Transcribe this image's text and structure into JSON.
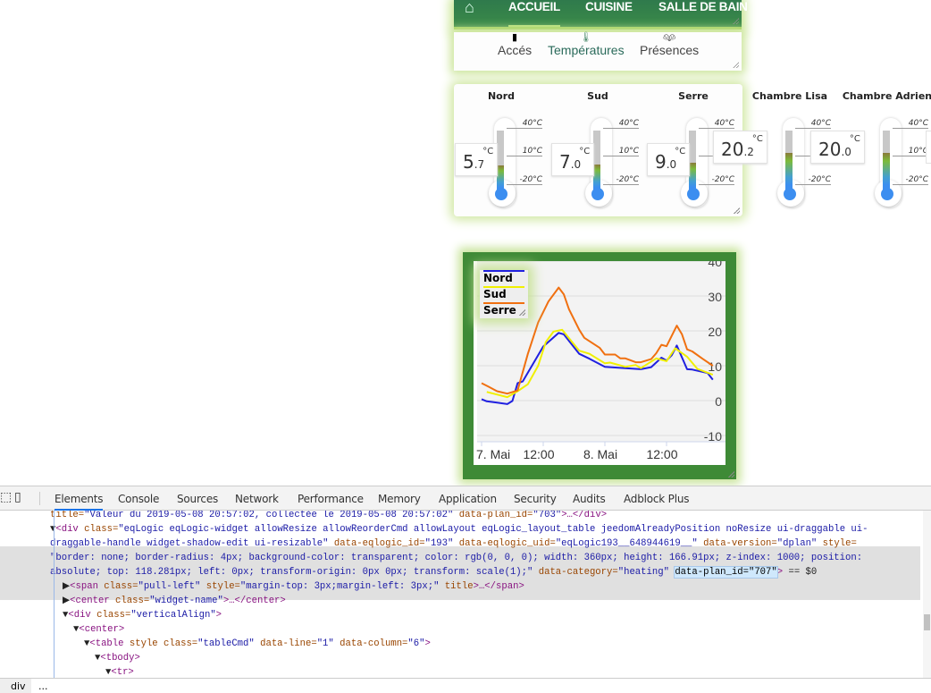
{
  "nav": {
    "home_icon": "house-icon",
    "items": [
      "ACCUEIL",
      "CUISINE",
      "SALLE DE BAIN"
    ],
    "active": "ACCUEIL"
  },
  "subnav": {
    "items": [
      {
        "label": "Accés",
        "icon": "door-icon"
      },
      {
        "label": "Températures",
        "icon": "thermometer-icon"
      },
      {
        "label": "Présences",
        "icon": "people-icon"
      }
    ]
  },
  "thermometers": {
    "scale": [
      "40°C",
      "10°C",
      "-20°C"
    ],
    "unit": "°C",
    "items": [
      {
        "name": "Nord",
        "int": "5",
        "dec": ".7",
        "value": 5.7
      },
      {
        "name": "Sud",
        "int": "7",
        "dec": ".0",
        "value": 7.0
      },
      {
        "name": "Serre",
        "int": "9",
        "dec": ".0",
        "value": 9.0
      },
      {
        "name": "Chambre Lisa",
        "int": "20",
        "dec": ".2",
        "value": 20.2
      },
      {
        "name": "Chambre Adrien",
        "int": "20",
        "dec": ".0",
        "value": 20.0
      }
    ]
  },
  "chart_data": {
    "type": "line",
    "title": "",
    "xlabel": "",
    "ylabel": "",
    "ylim": [
      -10,
      40
    ],
    "yticks": [
      "40",
      "30",
      "20",
      "10",
      "0",
      "-10"
    ],
    "xlim": [
      "2019-05-07 00:00",
      "2019-05-08 23:00"
    ],
    "xticks": [
      {
        "t": "2019-05-07 00:00",
        "label": "7. Mai"
      },
      {
        "t": "2019-05-07 12:00",
        "label": "12:00"
      },
      {
        "t": "2019-05-08 00:00",
        "label": "8. Mai"
      },
      {
        "t": "2019-05-08 12:00",
        "label": "12:00"
      }
    ],
    "grid": true,
    "legend": "top-left",
    "series": [
      {
        "name": "Nord",
        "color": "#2020e0",
        "points": [
          [
            "2019-05-07 00:00",
            0.4
          ],
          [
            "2019-05-07 01:00",
            -0.2
          ],
          [
            "2019-05-07 03:00",
            -0.6
          ],
          [
            "2019-05-07 05:00",
            -1
          ],
          [
            "2019-05-07 06:00",
            -0.1
          ],
          [
            "2019-05-07 07:00",
            5
          ],
          [
            "2019-05-07 08:00",
            5.5
          ],
          [
            "2019-05-07 12:00",
            15.5
          ],
          [
            "2019-05-07 15:00",
            19.4
          ],
          [
            "2019-05-07 16:00",
            19
          ],
          [
            "2019-05-07 19:00",
            13.4
          ],
          [
            "2019-05-07 21:00",
            12
          ],
          [
            "2019-05-08 00:00",
            9.7
          ],
          [
            "2019-05-08 04:00",
            9.3
          ],
          [
            "2019-05-08 07:00",
            9
          ],
          [
            "2019-05-08 09:00",
            9.6
          ],
          [
            "2019-05-08 11:00",
            12.3
          ],
          [
            "2019-05-08 12:00",
            11.5
          ],
          [
            "2019-05-08 13:00",
            13
          ],
          [
            "2019-05-08 14:00",
            15.8
          ],
          [
            "2019-05-08 16:00",
            9
          ],
          [
            "2019-05-08 17:00",
            8.9
          ],
          [
            "2019-05-08 20:00",
            7.9
          ],
          [
            "2019-05-08 21:00",
            6
          ]
        ]
      },
      {
        "name": "Sud",
        "color": "#f0f000",
        "points": [
          [
            "2019-05-07 01:00",
            2.5
          ],
          [
            "2019-05-07 05:00",
            1
          ],
          [
            "2019-05-07 07:00",
            2.7
          ],
          [
            "2019-05-07 09:00",
            4.7
          ],
          [
            "2019-05-07 11:00",
            10
          ],
          [
            "2019-05-07 12:30",
            16.8
          ],
          [
            "2019-05-07 14:00",
            19.8
          ],
          [
            "2019-05-07 15:40",
            20.3
          ],
          [
            "2019-05-07 19:00",
            14.3
          ],
          [
            "2019-05-07 21:00",
            13.4
          ],
          [
            "2019-05-08 00:00",
            10.7
          ],
          [
            "2019-05-08 01:00",
            10.9
          ],
          [
            "2019-05-08 04:00",
            9.7
          ],
          [
            "2019-05-08 06:00",
            10.2
          ],
          [
            "2019-05-08 07:00",
            9.3
          ],
          [
            "2019-05-08 10:00",
            12.1
          ],
          [
            "2019-05-08 12:00",
            11.3
          ],
          [
            "2019-05-08 13:40",
            15
          ],
          [
            "2019-05-08 16:00",
            12.6
          ],
          [
            "2019-05-08 18:00",
            9.1
          ],
          [
            "2019-05-08 21:00",
            7.4
          ]
        ]
      },
      {
        "name": "Serre",
        "color": "#f07010",
        "points": [
          [
            "2019-05-07 00:00",
            5
          ],
          [
            "2019-05-07 01:20",
            4
          ],
          [
            "2019-05-07 03:00",
            2.7
          ],
          [
            "2019-05-07 05:00",
            2
          ],
          [
            "2019-05-07 07:00",
            2.9
          ],
          [
            "2019-05-07 09:00",
            13.4
          ],
          [
            "2019-05-07 11:00",
            22.4
          ],
          [
            "2019-05-07 13:00",
            28.4
          ],
          [
            "2019-05-07 15:00",
            32.4
          ],
          [
            "2019-05-07 16:00",
            30.5
          ],
          [
            "2019-05-07 17:00",
            26.2
          ],
          [
            "2019-05-07 19:00",
            20.3
          ],
          [
            "2019-05-07 20:00",
            18
          ],
          [
            "2019-05-07 23:00",
            15.1
          ],
          [
            "2019-05-08 00:00",
            13.2
          ],
          [
            "2019-05-08 02:00",
            13.2
          ],
          [
            "2019-05-08 03:00",
            12.1
          ],
          [
            "2019-05-08 04:00",
            12.1
          ],
          [
            "2019-05-08 06:00",
            11
          ],
          [
            "2019-05-08 07:00",
            11
          ],
          [
            "2019-05-08 09:00",
            11.9
          ],
          [
            "2019-05-08 10:00",
            13.6
          ],
          [
            "2019-05-08 11:00",
            16
          ],
          [
            "2019-05-08 12:00",
            15.6
          ],
          [
            "2019-05-08 14:00",
            21.5
          ],
          [
            "2019-05-08 15:00",
            19
          ],
          [
            "2019-05-08 16:00",
            14.7
          ],
          [
            "2019-05-08 17:00",
            14.1
          ],
          [
            "2019-05-08 19:00",
            12
          ],
          [
            "2019-05-08 21:00",
            10
          ]
        ]
      }
    ]
  },
  "devtools": {
    "tabs": [
      "Elements",
      "Console",
      "Sources",
      "Network",
      "Performance",
      "Memory",
      "Application",
      "Security",
      "Audits",
      "Adblock Plus"
    ],
    "active_tab": "Elements",
    "lines": [
      {
        "indent": 56,
        "tokens": [
          [
            "an",
            "title="
          ],
          [
            "av",
            "\"Valeur du 2019-05-08 20:57:02, collectée le 2019-05-08 20:57:02\""
          ],
          [
            "an",
            " data-plan_id="
          ],
          [
            "av",
            "\"703\""
          ],
          [
            "tg",
            ">…</div>"
          ]
        ]
      },
      {
        "indent": 56,
        "tokens": [
          [
            "tx",
            "▼"
          ],
          [
            "tg",
            "<div"
          ],
          [
            "an",
            " class="
          ],
          [
            "av",
            "\"eqLogic eqLogic-widget allowResize allowReorderCmd allowLayout eqLogic_layout_table jeedomAlreadyPosition noResize ui-draggable ui-"
          ]
        ]
      },
      {
        "indent": 56,
        "tokens": [
          [
            "av",
            "draggable-handle widget-shadow-edit ui-resizable\""
          ],
          [
            "an",
            " data-eqlogic_id="
          ],
          [
            "av",
            "\"193\""
          ],
          [
            "an",
            " data-eqlogic_uid="
          ],
          [
            "av",
            "\"eqLogic193__648944619__\""
          ],
          [
            "an",
            " data-version="
          ],
          [
            "av",
            "\"dplan\""
          ],
          [
            "an",
            " style="
          ]
        ]
      },
      {
        "indent": 56,
        "tokens": [
          [
            "av",
            "\"border: none; border-radius: 4px; background-color: transparent; color: rgb(0, 0, 0); width: 360px; height: 166.91px; z-index: 1000; position:"
          ]
        ]
      },
      {
        "indent": 56,
        "tokens": [
          [
            "av",
            "absolute; top: 118.281px; left: 0px; transform-origin: 0px 0px; transform: scale(1);\""
          ],
          [
            "an",
            " data-category="
          ],
          [
            "av",
            "\"heating\" "
          ],
          [
            "sel",
            "data-plan_id=\"707\""
          ],
          [
            "tg",
            ">"
          ],
          [
            "tx",
            " == $0"
          ]
        ]
      },
      {
        "indent": 70,
        "tokens": [
          [
            "tx",
            "▶"
          ],
          [
            "tg",
            "<span"
          ],
          [
            "an",
            " class="
          ],
          [
            "av",
            "\"pull-left\""
          ],
          [
            "an",
            " style="
          ],
          [
            "av",
            "\"margin-top: 3px;margin-left: 3px;\""
          ],
          [
            "an",
            " title"
          ],
          [
            "tg",
            ">…</span>"
          ]
        ]
      },
      {
        "indent": 70,
        "tokens": [
          [
            "tx",
            "▶"
          ],
          [
            "tg",
            "<center"
          ],
          [
            "an",
            " class="
          ],
          [
            "av",
            "\"widget-name\""
          ],
          [
            "tg",
            ">…</center>"
          ]
        ]
      },
      {
        "indent": 70,
        "tokens": [
          [
            "tx",
            "▼"
          ],
          [
            "tg",
            "<div"
          ],
          [
            "an",
            " class="
          ],
          [
            "av",
            "\"verticalAlign\""
          ],
          [
            "tg",
            ">"
          ]
        ]
      },
      {
        "indent": 82,
        "tokens": [
          [
            "tx",
            "▼"
          ],
          [
            "tg",
            "<center>"
          ]
        ]
      },
      {
        "indent": 94,
        "tokens": [
          [
            "tx",
            "▼"
          ],
          [
            "tg",
            "<table"
          ],
          [
            "an",
            " style class="
          ],
          [
            "av",
            "\"tableCmd\""
          ],
          [
            "an",
            " data-line="
          ],
          [
            "av",
            "\"1\""
          ],
          [
            "an",
            " data-column="
          ],
          [
            "av",
            "\"6\""
          ],
          [
            "tg",
            ">"
          ]
        ]
      },
      {
        "indent": 106,
        "tokens": [
          [
            "tx",
            "▼"
          ],
          [
            "tg",
            "<tbody>"
          ]
        ]
      },
      {
        "indent": 118,
        "tokens": [
          [
            "tx",
            "▼"
          ],
          [
            "tg",
            "<tr>"
          ]
        ]
      }
    ],
    "breadcrumb": [
      "div",
      "..."
    ]
  }
}
